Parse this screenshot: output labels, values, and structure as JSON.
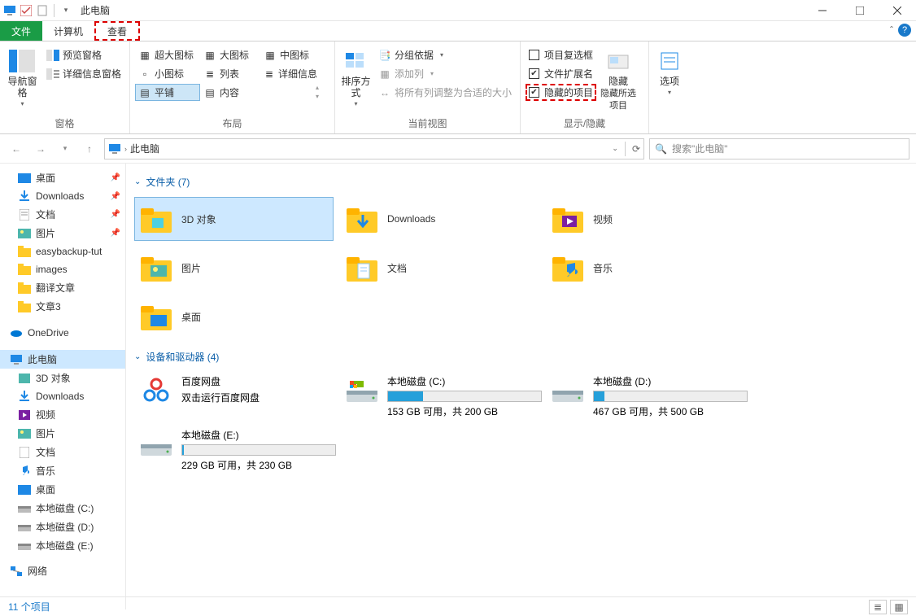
{
  "window": {
    "title": "此电脑"
  },
  "menubar": {
    "file": "文件",
    "computer": "计算机",
    "view": "查看"
  },
  "ribbon": {
    "panes": {
      "nav": "导航窗格",
      "preview": "预览窗格",
      "details": "详细信息窗格",
      "group": "窗格"
    },
    "layout": {
      "xlarge": "超大图标",
      "large": "大图标",
      "medium": "中图标",
      "small": "小图标",
      "list": "列表",
      "detail": "详细信息",
      "tiles": "平铺",
      "content": "内容",
      "group": "布局"
    },
    "view": {
      "sort": "排序方式",
      "groupby": "分组依据",
      "addcol": "添加列",
      "autosize": "将所有列调整为合适的大小",
      "group": "当前视图"
    },
    "showhide": {
      "itemcb": "项目复选框",
      "ext": "文件扩展名",
      "hidden": "隐藏的项目",
      "hide": "隐藏所选项目",
      "hidebtn": "隐藏",
      "group": "显示/隐藏"
    },
    "options": {
      "btn": "选项"
    }
  },
  "address": {
    "location": "此电脑"
  },
  "search": {
    "placeholder": "搜索\"此电脑\""
  },
  "sidebar": {
    "quick": [
      {
        "label": "桌面",
        "pin": true
      },
      {
        "label": "Downloads",
        "pin": true
      },
      {
        "label": "文档",
        "pin": true
      },
      {
        "label": "图片",
        "pin": true
      },
      {
        "label": "easybackup-tut",
        "pin": false
      },
      {
        "label": "images",
        "pin": false
      },
      {
        "label": "翻译文章",
        "pin": false
      },
      {
        "label": "文章3",
        "pin": false
      }
    ],
    "onedrive": "OneDrive",
    "thispc": "此电脑",
    "pcchildren": [
      "3D 对象",
      "Downloads",
      "视频",
      "图片",
      "文档",
      "音乐",
      "桌面",
      "本地磁盘 (C:)",
      "本地磁盘 (D:)",
      "本地磁盘 (E:)"
    ],
    "network": "网络"
  },
  "main": {
    "folders_header": "文件夹 (7)",
    "folders": [
      "3D 对象",
      "Downloads",
      "视频",
      "图片",
      "文档",
      "音乐",
      "桌面"
    ],
    "drives_header": "设备和驱动器 (4)",
    "baidu": {
      "name": "百度网盘",
      "sub": "双击运行百度网盘"
    },
    "drives": [
      {
        "name": "本地磁盘 (C:)",
        "sub": "153 GB 可用，共 200 GB",
        "fill": 23
      },
      {
        "name": "本地磁盘 (D:)",
        "sub": "467 GB 可用，共 500 GB",
        "fill": 7
      },
      {
        "name": "本地磁盘 (E:)",
        "sub": "229 GB 可用，共 230 GB",
        "fill": 1
      }
    ]
  },
  "status": {
    "items": "11 个项目"
  }
}
